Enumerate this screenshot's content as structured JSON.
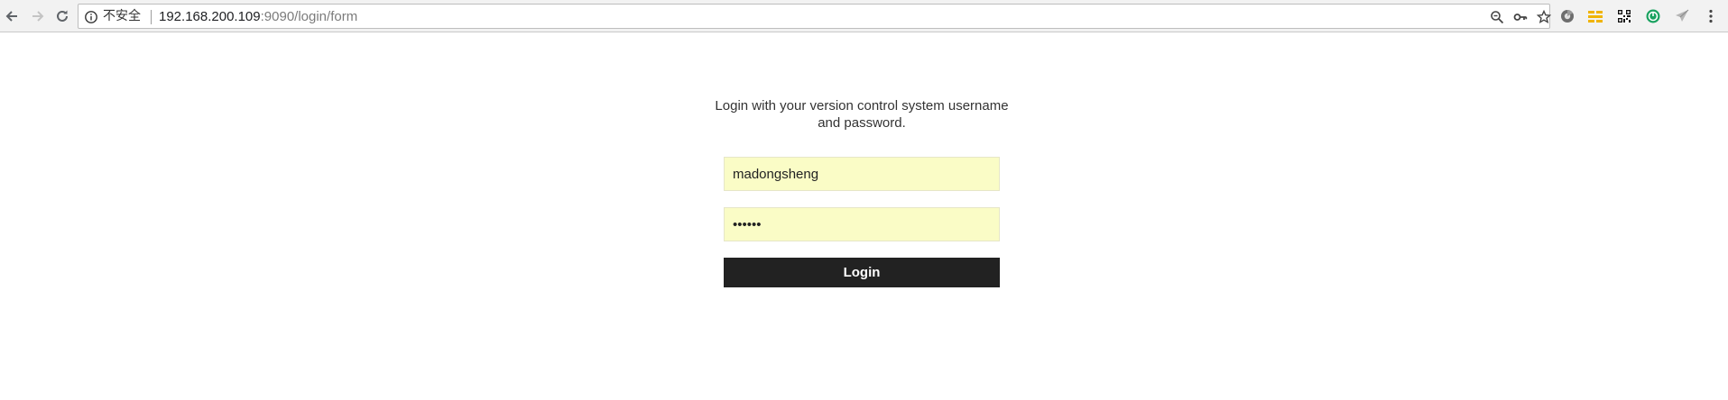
{
  "browser": {
    "security_label": "不安全",
    "url_host": "192.168.200.109",
    "url_path": ":9090/login/form",
    "nav_icons": [
      "back-arrow-icon",
      "forward-arrow-icon",
      "reload-icon"
    ],
    "omnibox_icons": [
      "zoom-icon",
      "key-icon",
      "bookmark-star-icon"
    ],
    "extension_icons": [
      "extension-gray-icon",
      "extension-orange-icon",
      "qr-code-icon",
      "extension-green-icon",
      "send-icon",
      "menu-dots-icon"
    ]
  },
  "login": {
    "prompt": "Login with your version control system username and password.",
    "username_value": "madongsheng",
    "password_value": "••••••",
    "button_label": "Login",
    "field_bg_color": "#fafcc6",
    "button_color": "#222222"
  }
}
